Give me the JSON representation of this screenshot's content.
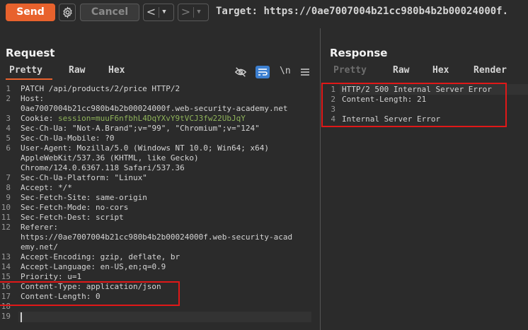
{
  "toolbar": {
    "send_label": "Send",
    "settings_icon": "gear-icon",
    "cancel_label": "Cancel",
    "back_arrow": "<",
    "forward_arrow": ">",
    "dropdown_glyph": "▼",
    "target_label": "Target:",
    "target_url": "https://0ae7007004b21cc980b4b2b00024000f."
  },
  "request": {
    "title": "Request",
    "tabs": [
      "Pretty",
      "Raw",
      "Hex"
    ],
    "active_tab": "Pretty",
    "tool_icons": [
      "hide-icon",
      "wrap-icon",
      "newline-icon",
      "menu-icon"
    ],
    "newline_label": "\\n",
    "line_numbers": [
      "1",
      "2",
      "3",
      "4",
      "5",
      "6",
      "7",
      "8",
      "9",
      "10",
      "11",
      "12",
      "13",
      "14",
      "15",
      "16",
      "17",
      "18",
      "19"
    ],
    "lines": [
      {
        "text": "PATCH /api/products/2/price HTTP/2"
      },
      {
        "key": "Host:"
      },
      {
        "text": "0ae7007004b21cc980b4b2b00024000f.web-security-academy.net"
      },
      {
        "key": "Cookie: ",
        "cookie_name": "session=",
        "cookie_value": "muuF6nfbhL4DqYXvY9tVCJ3fw22UbJqY"
      },
      {
        "key": "Sec-Ch-Ua: ",
        "value": "\"Not-A.Brand\";v=\"99\", \"Chromium\";v=\"124\""
      },
      {
        "key": "Sec-Ch-Ua-Mobile: ",
        "value": "?0"
      },
      {
        "key": "User-Agent: ",
        "value": "Mozilla/5.0 (Windows NT 10.0; Win64; x64)"
      },
      {
        "text": "AppleWebKit/537.36 (KHTML, like Gecko)"
      },
      {
        "text": "Chrome/124.0.6367.118 Safari/537.36"
      },
      {
        "key": "Sec-Ch-Ua-Platform: ",
        "value": "\"Linux\""
      },
      {
        "key": "Accept: ",
        "value": "*/*"
      },
      {
        "key": "Sec-Fetch-Site: ",
        "value": "same-origin"
      },
      {
        "key": "Sec-Fetch-Mode: ",
        "value": "no-cors"
      },
      {
        "key": "Sec-Fetch-Dest: ",
        "value": "script"
      },
      {
        "key": "Referer:"
      },
      {
        "text": "https://0ae7007004b21cc980b4b2b00024000f.web-security-acad"
      },
      {
        "text": "emy.net/"
      },
      {
        "key": "Accept-Encoding: ",
        "value": "gzip, deflate, br"
      },
      {
        "key": "Accept-Language: ",
        "value": "en-US,en;q=0.9"
      },
      {
        "key": "Priority: ",
        "value": "u=1"
      },
      {
        "key": "Content-Type: ",
        "value": "application/json"
      },
      {
        "key": "Content-Length: ",
        "value": "0"
      }
    ]
  },
  "response": {
    "title": "Response",
    "tabs": [
      "Pretty",
      "Raw",
      "Hex",
      "Render"
    ],
    "active_tab": "Raw",
    "line_numbers": [
      "1",
      "2",
      "3",
      "4"
    ],
    "lines": [
      {
        "text": "HTTP/2 500 Internal Server Error"
      },
      {
        "key": "Content-Length: ",
        "value": "21"
      },
      {
        "text": ""
      },
      {
        "text": "Internal Server Error"
      }
    ]
  },
  "colors": {
    "accent": "#e8622d",
    "highlight_box": "#e01818",
    "cookie_value": "#8fb35a",
    "background": "#2b2b2b"
  }
}
